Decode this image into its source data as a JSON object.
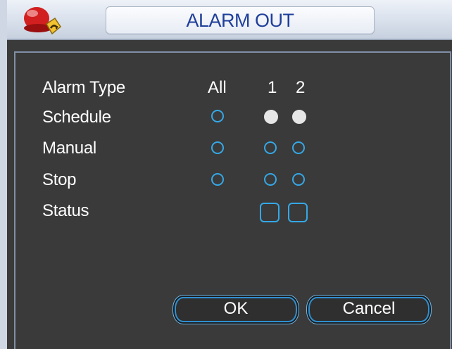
{
  "window": {
    "title": "ALARM OUT"
  },
  "table": {
    "header_label": "Alarm Type",
    "columns": [
      "All",
      "1",
      "2"
    ],
    "rows": [
      {
        "label": "Schedule",
        "all": false,
        "ch": [
          true,
          true
        ]
      },
      {
        "label": "Manual",
        "all": false,
        "ch": [
          false,
          false
        ]
      },
      {
        "label": "Stop",
        "all": false,
        "ch": [
          false,
          false
        ]
      }
    ],
    "status_label": "Status"
  },
  "buttons": {
    "ok": "OK",
    "cancel": "Cancel"
  },
  "colors": {
    "accent": "#35a8e6",
    "title_text": "#1f3f9a",
    "panel_bg": "#3a3a3a"
  },
  "icons": {
    "app": "alarm-siren-icon"
  }
}
